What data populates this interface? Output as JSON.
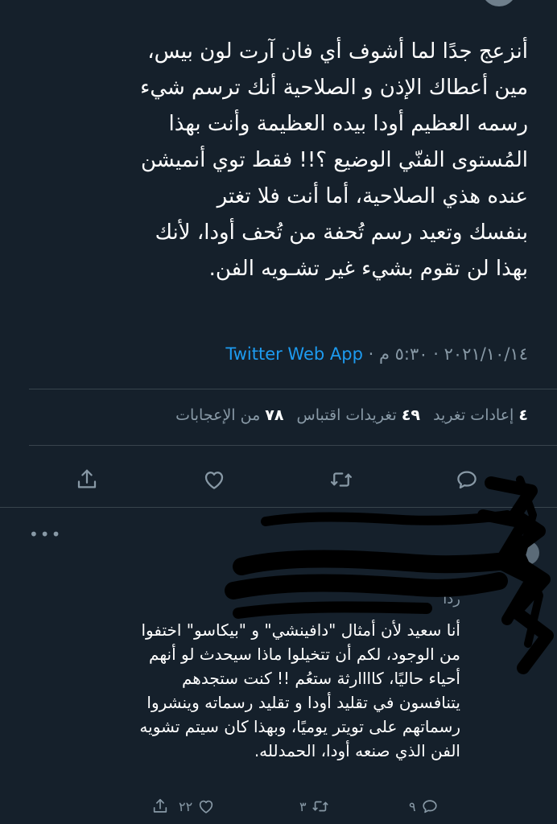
{
  "tweet": {
    "lines": [
      "أنزعج جدًا لما أشوف أي فان آرت لون بيس،",
      "مين أعطاك الإذن و الصلاحية أنك ترسم شيء",
      "رسمه العظيم أودا بيده العظيمة وأنت بهذا",
      "المُستوى الفنّي الوضيع ؟!! فقط توي أنميشن",
      "عنده هذي الصلاحية، أما أنت فلا تغتر",
      "بنفسك وتعيد رسم تُحفة من تُحف أودا، لأنك",
      "بهذا لن تقوم بشيء غير تشـويه الفن."
    ],
    "date": "٢٠٢١/١٠/١٤",
    "time": "٥:٣٠ م",
    "app": "Twitter Web App"
  },
  "stats": {
    "retweets_count": "٤",
    "retweets_label": "إعادات تغريد",
    "quotes_count": "٤٩",
    "quotes_label": "تغريدات اقتباس",
    "likes_count": "٧٨",
    "likes_label": "من الإعجابات"
  },
  "icons": {
    "reply": "reply-icon",
    "retweet": "retweet-icon",
    "like": "heart-icon",
    "share": "share-icon"
  },
  "reply": {
    "more": "•••",
    "prefix": "ردًا",
    "lines": [
      "أنا سعيد لأن أمثال \"دافينشي\" و \"بيكاسو\" اختفوا",
      "من الوجود، لكم أن تتخيلوا ماذا سيحدث لو أنهم",
      "أحياء حاليًا، كاااارثة ستعُم !! كنت ستجدهم",
      "يتنافسون في تقليد أودا و تقليد رسماته وينشروا",
      "رسماتهم على تويتر يوميًا، وبهذا كان سيتم تشويه",
      "الفن الذي صنعه أودا، الحمدلله."
    ],
    "reply_count": "٩",
    "retweet_count": "٣",
    "like_count": "٢٢"
  },
  "colors": {
    "background": "#15202b",
    "accent": "#1d9bf0",
    "secondary_text": "#8899a6",
    "divider": "#38444d"
  }
}
